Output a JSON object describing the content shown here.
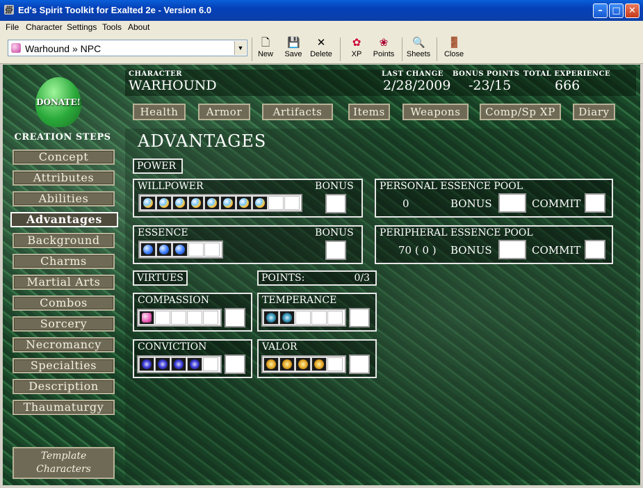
{
  "window": {
    "title": "Ed's Spirit Toolkit for Exalted 2e - Version 6.0",
    "controls": [
      "minimize",
      "maximize",
      "close"
    ]
  },
  "menu": [
    "File",
    "Character",
    "Settings",
    "Tools",
    "About"
  ],
  "toolbar": {
    "character_select": "Warhound » NPC",
    "buttons": [
      {
        "label": "New",
        "icon": "new-file-icon"
      },
      {
        "label": "Save",
        "icon": "floppy-disk-icon"
      },
      {
        "label": "Delete",
        "icon": "x-delete-icon"
      },
      {
        "label": "XP",
        "icon": "xp-icon"
      },
      {
        "label": "Points",
        "icon": "points-icon"
      },
      {
        "label": "Sheets",
        "icon": "sheets-icon"
      },
      {
        "label": "Close",
        "icon": "exit-door-icon"
      }
    ]
  },
  "sidebar": {
    "donate_label": "DONATE!",
    "steps_heading": "CREATION STEPS",
    "steps": [
      "Concept",
      "Attributes",
      "Abilities",
      "Advantages",
      "Background",
      "Charms",
      "Martial Arts",
      "Combos",
      "Sorcery",
      "Necromancy",
      "Specialties",
      "Description",
      "Thaumaturgy"
    ],
    "active_step": "Advantages",
    "template_line1": "Template",
    "template_line2": "Characters"
  },
  "header": {
    "character_label": "CHARACTER",
    "character_name": "WARHOUND",
    "last_change_label": "LAST CHANGE",
    "last_change": "2/28/2009",
    "bonus_points_label": "BONUS POINTS",
    "bonus_points": "-23/15",
    "total_xp_label": "TOTAL EXPERIENCE",
    "total_xp": "666"
  },
  "nav": [
    "Health",
    "Armor",
    "Artifacts",
    "Items",
    "Weapons",
    "Comp/Sp XP",
    "Diary"
  ],
  "advantages": {
    "title": "ADVANTAGES",
    "power_label": "POWER",
    "willpower": {
      "label": "WILLPOWER",
      "bonus_label": "BONUS",
      "filled": 8,
      "total": 10
    },
    "essence": {
      "label": "ESSENCE",
      "bonus_label": "BONUS",
      "filled": 3,
      "total": 5
    },
    "personal_pool": {
      "label": "PERSONAL ESSENCE POOL",
      "value": "0",
      "bonus_label": "BONUS",
      "commit_label": "COMMIT"
    },
    "peripheral_pool": {
      "label": "PERIPHERAL ESSENCE POOL",
      "value": "70 ( 0 )",
      "bonus_label": "BONUS",
      "commit_label": "COMMIT"
    },
    "virtues_label": "VIRTUES",
    "points_label": "POINTS:",
    "points_value": "0/3",
    "compassion": {
      "label": "COMPASSION",
      "filled": 1,
      "total": 5
    },
    "temperance": {
      "label": "TEMPERANCE",
      "filled": 2,
      "total": 5
    },
    "conviction": {
      "label": "CONVICTION",
      "filled": 4,
      "total": 5
    },
    "valor": {
      "label": "VALOR",
      "filled": 4,
      "total": 5
    }
  }
}
